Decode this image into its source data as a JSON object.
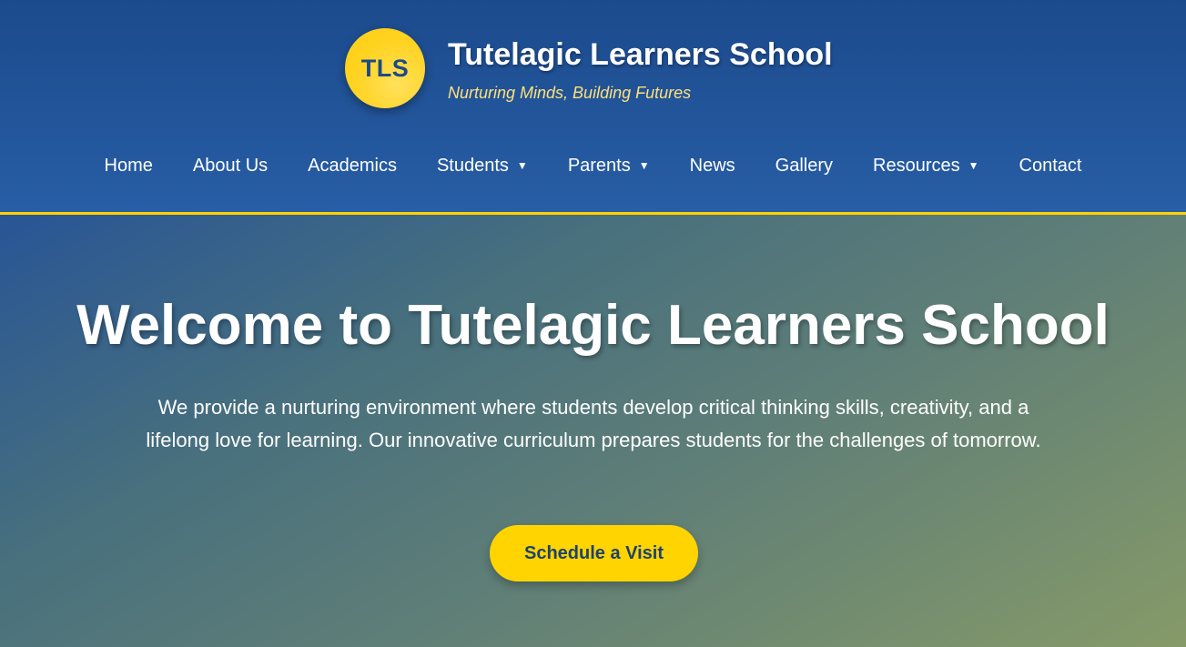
{
  "header": {
    "logo_text": "TLS",
    "title": "Tutelagic Learners School",
    "tagline": "Nurturing Minds, Building Futures"
  },
  "nav": {
    "items": [
      {
        "label": "Home",
        "has_dropdown": false
      },
      {
        "label": "About Us",
        "has_dropdown": false
      },
      {
        "label": "Academics",
        "has_dropdown": false
      },
      {
        "label": "Students",
        "has_dropdown": true
      },
      {
        "label": "Parents",
        "has_dropdown": true
      },
      {
        "label": "News",
        "has_dropdown": false
      },
      {
        "label": "Gallery",
        "has_dropdown": false
      },
      {
        "label": "Resources",
        "has_dropdown": true
      },
      {
        "label": "Contact",
        "has_dropdown": false
      }
    ],
    "dropdown_icon": "▼"
  },
  "hero": {
    "title": "Welcome to Tutelagic Learners School",
    "description": "We provide a nurturing environment where students develop critical thinking skills, creativity, and a lifelong love for learning. Our innovative curriculum prepares students for the challenges of tomorrow.",
    "cta_label": "Schedule a Visit"
  },
  "colors": {
    "header_blue": "#1c4a8d",
    "accent_yellow": "#ffd400",
    "tagline_yellow": "#ffe07a",
    "button_text": "#1d416e"
  }
}
